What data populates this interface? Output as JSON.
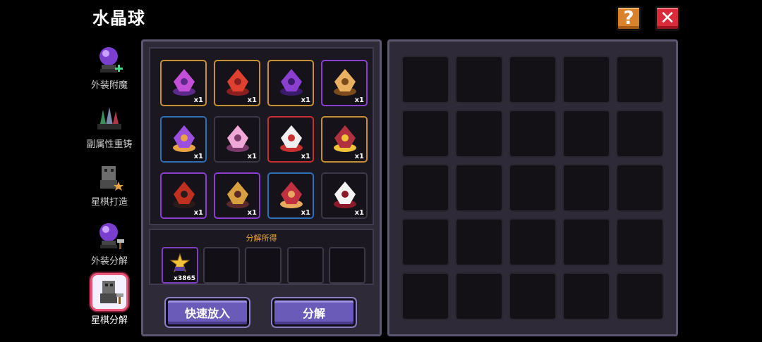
{
  "header": {
    "title": "水晶球",
    "help_label": "?",
    "close_label": "✕"
  },
  "sidebar": {
    "items": [
      {
        "label": "外装附魔",
        "icon": "crystal-ball-plus-icon",
        "active": false
      },
      {
        "label": "副属性重铸",
        "icon": "gem-crystals-icon",
        "active": false
      },
      {
        "label": "星棋打造",
        "icon": "chess-piece-star-icon",
        "active": false
      },
      {
        "label": "外装分解",
        "icon": "crystal-ball-hammer-icon",
        "active": false
      },
      {
        "label": "星棋分解",
        "icon": "chess-piece-hammer-icon",
        "active": true
      }
    ]
  },
  "decompose_items": [
    {
      "icon": "purple-spellbook-icon",
      "rarity": "gold",
      "qty": "x1"
    },
    {
      "icon": "red-crystal-staff-icon",
      "rarity": "gold",
      "qty": "x1"
    },
    {
      "icon": "purple-crystal-staff-icon",
      "rarity": "gold",
      "qty": "x1"
    },
    {
      "icon": "golden-horns-helmet-icon",
      "rarity": "purple",
      "qty": "x1"
    },
    {
      "icon": "purple-robe-icon",
      "rarity": "blue",
      "qty": "x1"
    },
    {
      "icon": "pink-horns-icon",
      "rarity": "gray",
      "qty": "x1"
    },
    {
      "icon": "white-dragon-mask-icon",
      "rarity": "red",
      "qty": "x1"
    },
    {
      "icon": "red-gem-box-icon",
      "rarity": "gold",
      "qty": "x1"
    },
    {
      "icon": "red-witch-hat-icon",
      "rarity": "purple",
      "qty": "x1"
    },
    {
      "icon": "golden-bell-pot-icon",
      "rarity": "purple",
      "qty": "x1"
    },
    {
      "icon": "red-bow-pot-icon",
      "rarity": "blue",
      "qty": "x1"
    },
    {
      "icon": "white-ghost-hat-icon",
      "rarity": "gray",
      "qty": "x1"
    }
  ],
  "yield": {
    "title": "分解所得",
    "slots": [
      {
        "icon": "star-shard-icon",
        "qty": "x3865"
      },
      {
        "icon": "",
        "qty": ""
      },
      {
        "icon": "",
        "qty": ""
      },
      {
        "icon": "",
        "qty": ""
      },
      {
        "icon": "",
        "qty": ""
      }
    ]
  },
  "actions": {
    "quick_add_label": "快速放入",
    "decompose_label": "分解"
  },
  "inventory": {
    "rows": 5,
    "cols": 5
  },
  "colors": {
    "gold": "#c79032",
    "purple": "#8a3fd1",
    "blue": "#2f6fb8",
    "red": "#c63030",
    "gray": "#3c3847",
    "button": "#6b5bb8",
    "help": "#d9822b",
    "close": "#d92b3a"
  }
}
